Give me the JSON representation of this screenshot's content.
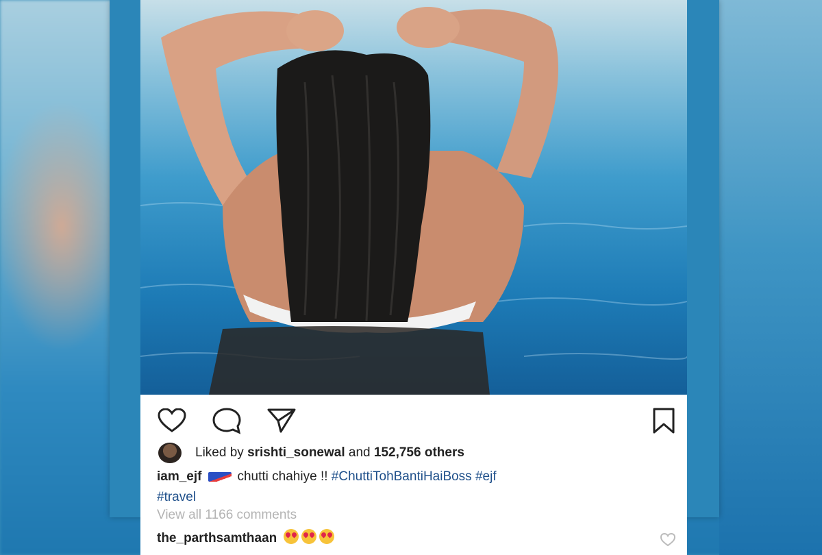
{
  "post": {
    "liked_by_prefix": "Liked by",
    "liked_by_user": "srishti_sonewal",
    "liked_by_and": "and",
    "liked_by_count": "152,756 others",
    "caption_user": "iam_ejf",
    "caption_text": "chutti chahiye !!",
    "caption_tags": [
      "#ChuttiTohBantiHaiBoss",
      "#ejf",
      "#travel"
    ],
    "view_all_comments": "View all 1166 comments",
    "comment_user": "the_parthsamthaan",
    "comment_emoji_count": 3
  },
  "icons": {
    "like": "heart-icon",
    "comment": "comment-icon",
    "share": "send-icon",
    "save": "bookmark-icon"
  },
  "colors": {
    "hashtag": "#1e4f8a",
    "muted": "#b3b3b3",
    "text": "#222222",
    "water": "#1d7bb6"
  }
}
